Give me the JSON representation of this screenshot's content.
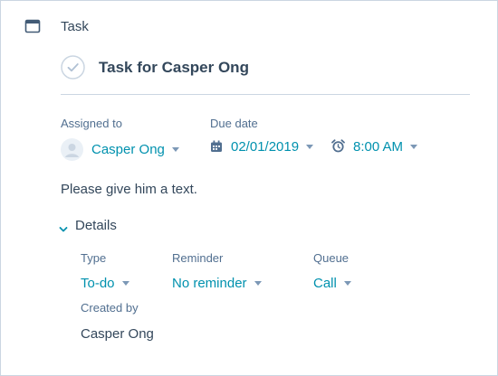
{
  "header": {
    "label": "Task",
    "icon": "task-icon"
  },
  "task": {
    "title": "Task for Casper Ong",
    "status_icon": "check-circle-icon"
  },
  "assigned_to": {
    "label": "Assigned to",
    "value": "Casper Ong",
    "avatar_icon": "avatar-icon"
  },
  "due_date": {
    "label": "Due date",
    "date": "02/01/2019",
    "time": "8:00 AM",
    "date_icon": "calendar-icon",
    "time_icon": "alarm-clock-icon"
  },
  "note": "Please give him a text.",
  "details": {
    "toggle_label": "Details",
    "type": {
      "label": "Type",
      "value": "To-do"
    },
    "reminder": {
      "label": "Reminder",
      "value": "No reminder"
    },
    "queue": {
      "label": "Queue",
      "value": "Call"
    },
    "created_by": {
      "label": "Created by",
      "value": "Casper Ong"
    }
  },
  "colors": {
    "accent": "#0091ae",
    "text": "#33475b",
    "label": "#516f90",
    "border": "#cbd6e2"
  }
}
